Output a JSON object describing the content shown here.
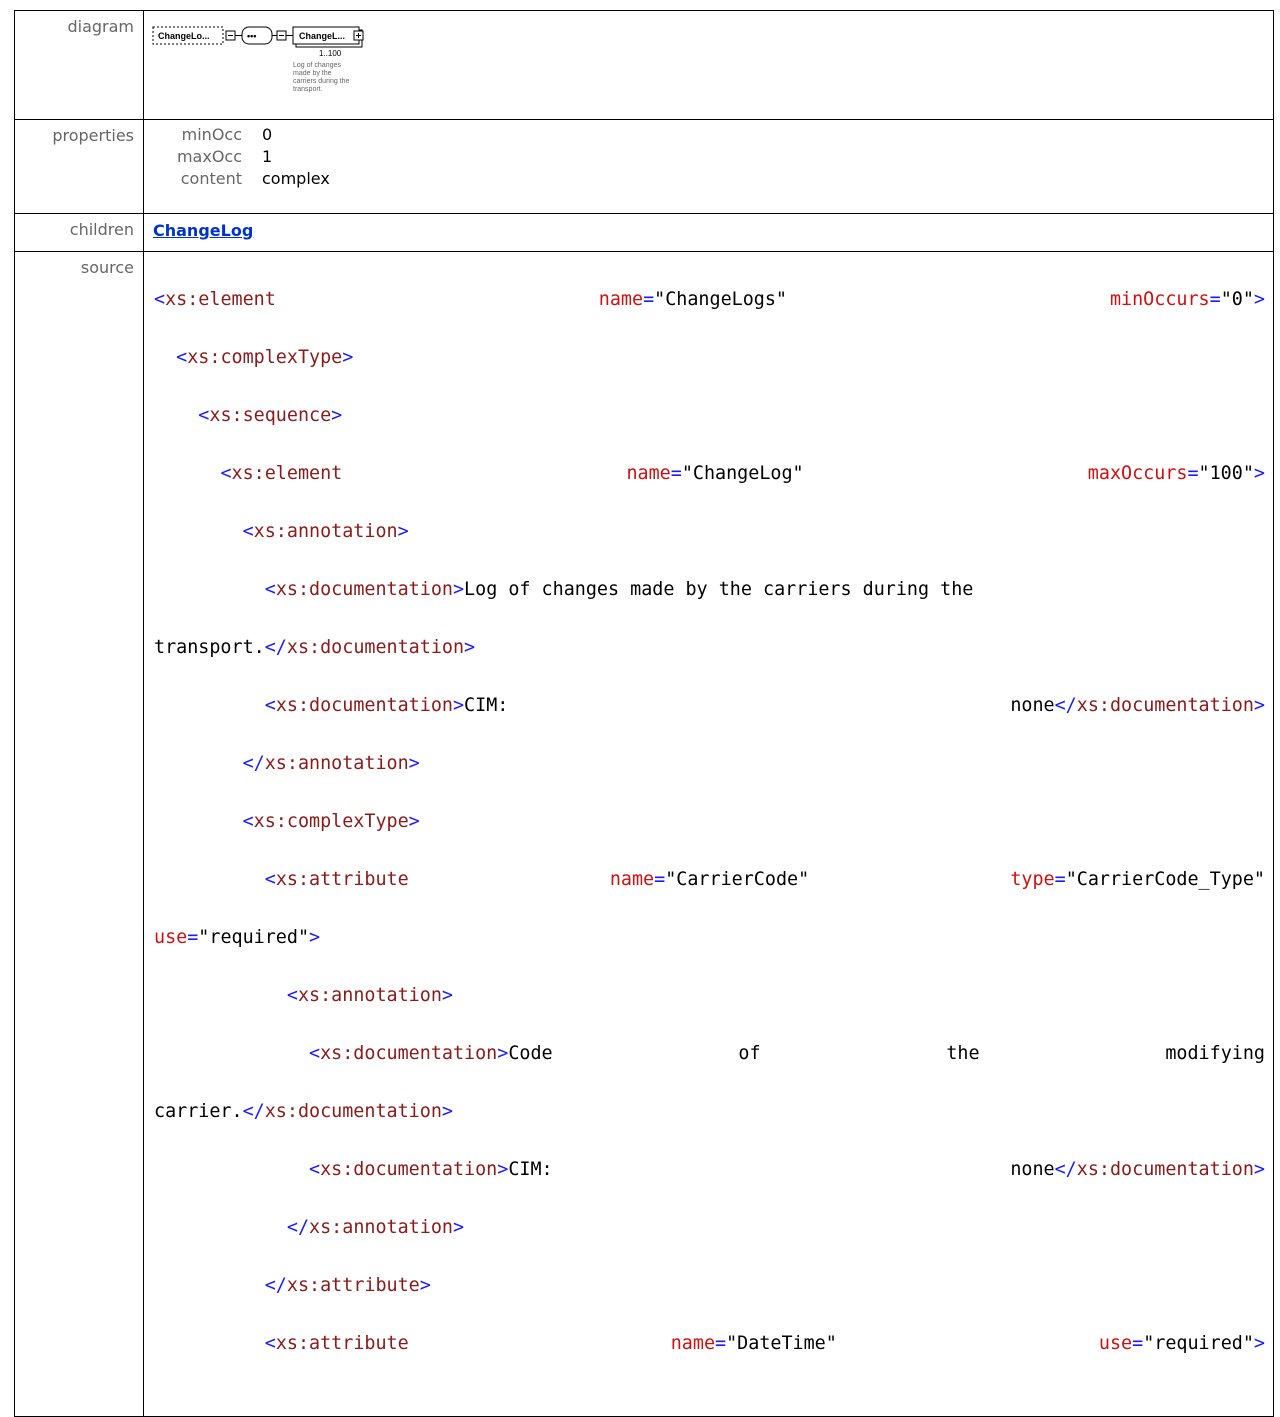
{
  "heading": "…",
  "labels": {
    "diagram": "diagram",
    "properties": "properties",
    "children": "children",
    "source": "source"
  },
  "diagram": {
    "root_box": "ChangeLo...",
    "seq_dots": "•••",
    "child_box": "ChangeL...",
    "child_occurs": "1..100",
    "annotation_lines": [
      "Log of changes",
      "made by the",
      "carriers during the",
      "transport."
    ]
  },
  "properties": [
    {
      "key": "minOcc",
      "value": "0"
    },
    {
      "key": "maxOcc",
      "value": "1"
    },
    {
      "key": "content",
      "value": "complex"
    }
  ],
  "children": {
    "link": "ChangeLog"
  },
  "source": {
    "l1": {
      "tag": "xs:element",
      "attr1": "name",
      "val1": "\"ChangeLogs\"",
      "attr2": "minOccurs",
      "val2": "\"0\""
    },
    "l2": {
      "tag": "xs:complexType"
    },
    "l3": {
      "tag": "xs:sequence"
    },
    "l4": {
      "tag": "xs:element",
      "attr1": "name",
      "val1": "\"ChangeLog\"",
      "attr2": "maxOccurs",
      "val2": "\"100\""
    },
    "l5": {
      "tag": "xs:annotation"
    },
    "l6": {
      "tag": "xs:documentation",
      "text": "Log of changes made by the carriers during the",
      "close": "xs:documentation"
    },
    "l7": {
      "text": "transport."
    },
    "l8": {
      "tag": "xs:documentation",
      "text1": "CIM:",
      "text2": "none",
      "close": "xs:documentation"
    },
    "l9": {
      "close": "xs:annotation"
    },
    "l10": {
      "tag": "xs:complexType"
    },
    "l11": {
      "tag": "xs:attribute",
      "attr1": "name",
      "val1": "\"CarrierCode\"",
      "attr2": "type",
      "val2": "\"CarrierCode_Type\""
    },
    "l12": {
      "attr": "use",
      "val": "\"required\""
    },
    "l13": {
      "tag": "xs:annotation"
    },
    "l14": {
      "tag": "xs:documentation",
      "w1": "Code",
      "w2": "of",
      "w3": "the",
      "w4": "modifying"
    },
    "l15": {
      "text": "carrier.",
      "close": "xs:documentation"
    },
    "l16": {
      "tag": "xs:documentation",
      "text1": "CIM:",
      "text2": "none",
      "close": "xs:documentation"
    },
    "l17": {
      "close": "xs:annotation"
    },
    "l18": {
      "close": "xs:attribute"
    },
    "l19": {
      "tag": "xs:attribute",
      "attr1": "name",
      "val1": "\"DateTime\"",
      "attr2": "use",
      "val2": "\"required\""
    }
  }
}
